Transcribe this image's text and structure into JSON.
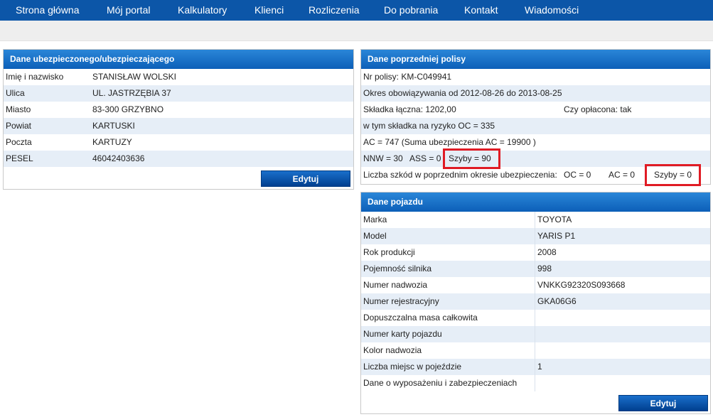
{
  "nav": {
    "items": [
      "Strona główna",
      "Mój portal",
      "Kalkulatory",
      "Klienci",
      "Rozliczenia",
      "Do pobrania",
      "Kontakt",
      "Wiadomości"
    ]
  },
  "insured": {
    "title": "Dane ubezpieczonego/ubezpieczającego",
    "rows": [
      {
        "label": "Imię i nazwisko",
        "value": "STANISŁAW WOLSKI"
      },
      {
        "label": "Ulica",
        "value": "UL. JASTRZĘBIA 37"
      },
      {
        "label": "Miasto",
        "value": "83-300 GRZYBNO"
      },
      {
        "label": "Powiat",
        "value": "KARTUSKI"
      },
      {
        "label": "Poczta",
        "value": "KARTUZY"
      },
      {
        "label": "PESEL",
        "value": "46042403636"
      }
    ],
    "edit_label": "Edytuj"
  },
  "policy": {
    "title": "Dane poprzedniej polisy",
    "number": "Nr polisy: KM-C049941",
    "period": "Okres obowiązywania od  2012-08-26 do 2013-08-25",
    "premium": "Składka łączna: 1202,00",
    "paid": "Czy opłacona: tak",
    "oc": "w tym składka na ryzyko OC =  335",
    "ac": "AC = 747  (Suma ubezpieczenia AC = 19900 )",
    "nnw": "NNW = 30",
    "ass": "ASS = 0",
    "szyby": "Szyby = 90",
    "claims_label": "Liczba szkód w poprzednim okresie ubezpieczenia:",
    "claims_oc": "OC = 0",
    "claims_ac": "AC = 0",
    "claims_szyby": "Szyby = 0"
  },
  "vehicle": {
    "title": "Dane pojazdu",
    "rows": [
      {
        "label": "Marka",
        "value": "TOYOTA"
      },
      {
        "label": "Model",
        "value": "YARIS P1"
      },
      {
        "label": "Rok produkcji",
        "value": "2008"
      },
      {
        "label": "Pojemność silnika",
        "value": "998"
      },
      {
        "label": "Numer nadwozia",
        "value": "VNKKG92320S093668"
      },
      {
        "label": "Numer rejestracyjny",
        "value": "GKA06G6"
      },
      {
        "label": "Dopuszczalna masa całkowita",
        "value": ""
      },
      {
        "label": "Numer karty pojazdu",
        "value": ""
      },
      {
        "label": "Kolor nadwozia",
        "value": ""
      },
      {
        "label": "Liczba miejsc w pojeździe",
        "value": "1"
      },
      {
        "label": "Dane o wyposażeniu i zabezpieczeniach",
        "value": ""
      }
    ],
    "edit_label": "Edytuj"
  }
}
